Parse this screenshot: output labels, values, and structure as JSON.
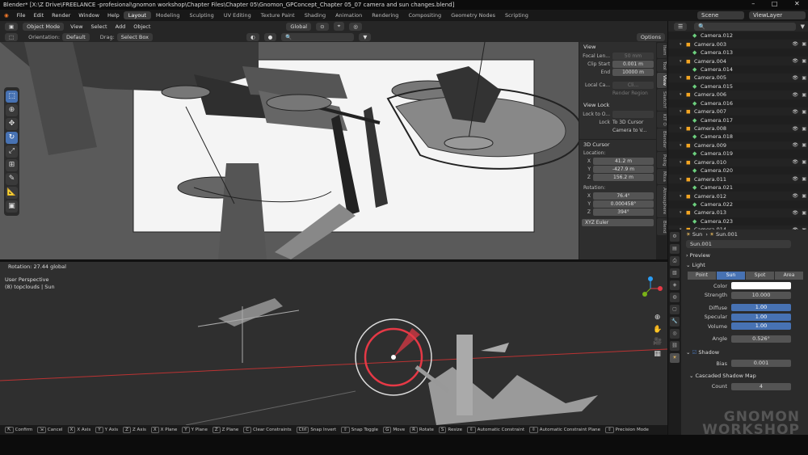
{
  "titlebar": {
    "text": "Blender* [X:\\Z Drive\\FREELANCE -profesional\\gnomon workshop\\Chapter Files\\Chapter 05\\Gnomon_GPConcept_Chapter 05_07 camera and sun changes.blend]"
  },
  "menus": [
    "File",
    "Edit",
    "Render",
    "Window",
    "Help"
  ],
  "workspaces": [
    "Layout",
    "Modeling",
    "Sculpting",
    "UV Editing",
    "Texture Paint",
    "Shading",
    "Animation",
    "Rendering",
    "Compositing",
    "Geometry Nodes",
    "Scripting"
  ],
  "scene": "Scene",
  "view_layer": "ViewLayer",
  "header": {
    "mode": "Object Mode",
    "view": "View",
    "select": "Select",
    "add": "Add",
    "object": "Object",
    "transform": "Global",
    "options": "Options"
  },
  "header2": {
    "orientation_label": "Orientation:",
    "orientation": "Default",
    "drag_label": "Drag:",
    "drag": "Select Box"
  },
  "npanel": {
    "view_title": "View",
    "focal_label": "Focal Len...",
    "focal": "50 mm",
    "clip_start_label": "Clip Start",
    "clip_start": "0.001 m",
    "end_label": "End",
    "end": "10000 m",
    "local_cam_label": "Local Ca...",
    "local_cam": "Cli...",
    "render_region": "Render Region",
    "view_lock_title": "View Lock",
    "lock_obj_label": "Lock to O...",
    "lock_label": "Lock",
    "to_3d_cursor": "To 3D Cursor",
    "camera_to_view": "Camera to V...",
    "cursor_title": "3D Cursor",
    "location": "Location:",
    "x": "X",
    "x_val": "41.2 m",
    "y": "Y",
    "y_val": "-427.9 m",
    "z": "Z",
    "z_val": "156.2 m",
    "rotation": "Rotation:",
    "rx_val": "76.4°",
    "ry_val": "0.000458°",
    "rz_val": "394°",
    "rot_mode": "XYZ Euler"
  },
  "ntabs": [
    "Item",
    "Tool",
    "View",
    "Sketchf",
    "KIT O",
    "Blender",
    "Poliig",
    "Mixa",
    "Atmosphere",
    "Blend"
  ],
  "rotation_text": "Rotation: 27.44 global",
  "viewport2": {
    "perspective": "User Perspective",
    "collection": "(8) topclouds | Sun"
  },
  "outliner": [
    {
      "name": "Camera.012",
      "indent": 2
    },
    {
      "name": "Camera.003",
      "indent": 1
    },
    {
      "name": "Camera.013",
      "indent": 2
    },
    {
      "name": "Camera.004",
      "indent": 1
    },
    {
      "name": "Camera.014",
      "indent": 2
    },
    {
      "name": "Camera.005",
      "indent": 1
    },
    {
      "name": "Camera.015",
      "indent": 2
    },
    {
      "name": "Camera.006",
      "indent": 1
    },
    {
      "name": "Camera.016",
      "indent": 2
    },
    {
      "name": "Camera.007",
      "indent": 1
    },
    {
      "name": "Camera.017",
      "indent": 2
    },
    {
      "name": "Camera.008",
      "indent": 1
    },
    {
      "name": "Camera.018",
      "indent": 2
    },
    {
      "name": "Camera.009",
      "indent": 1
    },
    {
      "name": "Camera.019",
      "indent": 2
    },
    {
      "name": "Camera.010",
      "indent": 1
    },
    {
      "name": "Camera.020",
      "indent": 2
    },
    {
      "name": "Camera.011",
      "indent": 1
    },
    {
      "name": "Camera.021",
      "indent": 2
    },
    {
      "name": "Camera.012",
      "indent": 1
    },
    {
      "name": "Camera.022",
      "indent": 2
    },
    {
      "name": "Camera.013",
      "indent": 1
    },
    {
      "name": "Camera.023",
      "indent": 2
    },
    {
      "name": "Camera.014",
      "indent": 1
    }
  ],
  "props": {
    "obj": "Sun",
    "data": "Sun.001",
    "datablock": "Sun.001",
    "preview": "Preview",
    "light": "Light",
    "types": [
      "Point",
      "Sun",
      "Spot",
      "Area"
    ],
    "color_label": "Color",
    "strength_label": "Strength",
    "strength": "10.000",
    "diffuse_label": "Diffuse",
    "diffuse": "1.00",
    "specular_label": "Specular",
    "specular": "1.00",
    "volume_label": "Volume",
    "volume": "1.00",
    "angle_label": "Angle",
    "angle": "0.526°",
    "shadow": "Shadow",
    "bias_label": "Bias",
    "bias": "0.001",
    "cascaded": "Cascaded Shadow Map",
    "count_label": "Count",
    "count": "4"
  },
  "statusbar": [
    {
      "k": "",
      "t": "Confirm"
    },
    {
      "k": "",
      "t": "Cancel"
    },
    {
      "k": "X",
      "t": "X Axis"
    },
    {
      "k": "Y",
      "t": "Y Axis"
    },
    {
      "k": "Z",
      "t": "Z Axis"
    },
    {
      "k": "X",
      "t": "X Plane"
    },
    {
      "k": "Y",
      "t": "Y Plane"
    },
    {
      "k": "Z",
      "t": "Z Plane"
    },
    {
      "k": "C",
      "t": "Clear Constraints"
    },
    {
      "k": "Ctrl",
      "t": "Snap Invert"
    },
    {
      "k": "",
      "t": "Snap Toggle"
    },
    {
      "k": "G",
      "t": "Move"
    },
    {
      "k": "R",
      "t": "Rotate"
    },
    {
      "k": "S",
      "t": "Resize"
    },
    {
      "k": "",
      "t": "Automatic Constraint"
    },
    {
      "k": "",
      "t": "Automatic Constraint Plane"
    },
    {
      "k": "",
      "t": "Precision Mode"
    }
  ],
  "watermark": {
    "line1": "GNOMON",
    "line2": "WORKSHOP"
  }
}
